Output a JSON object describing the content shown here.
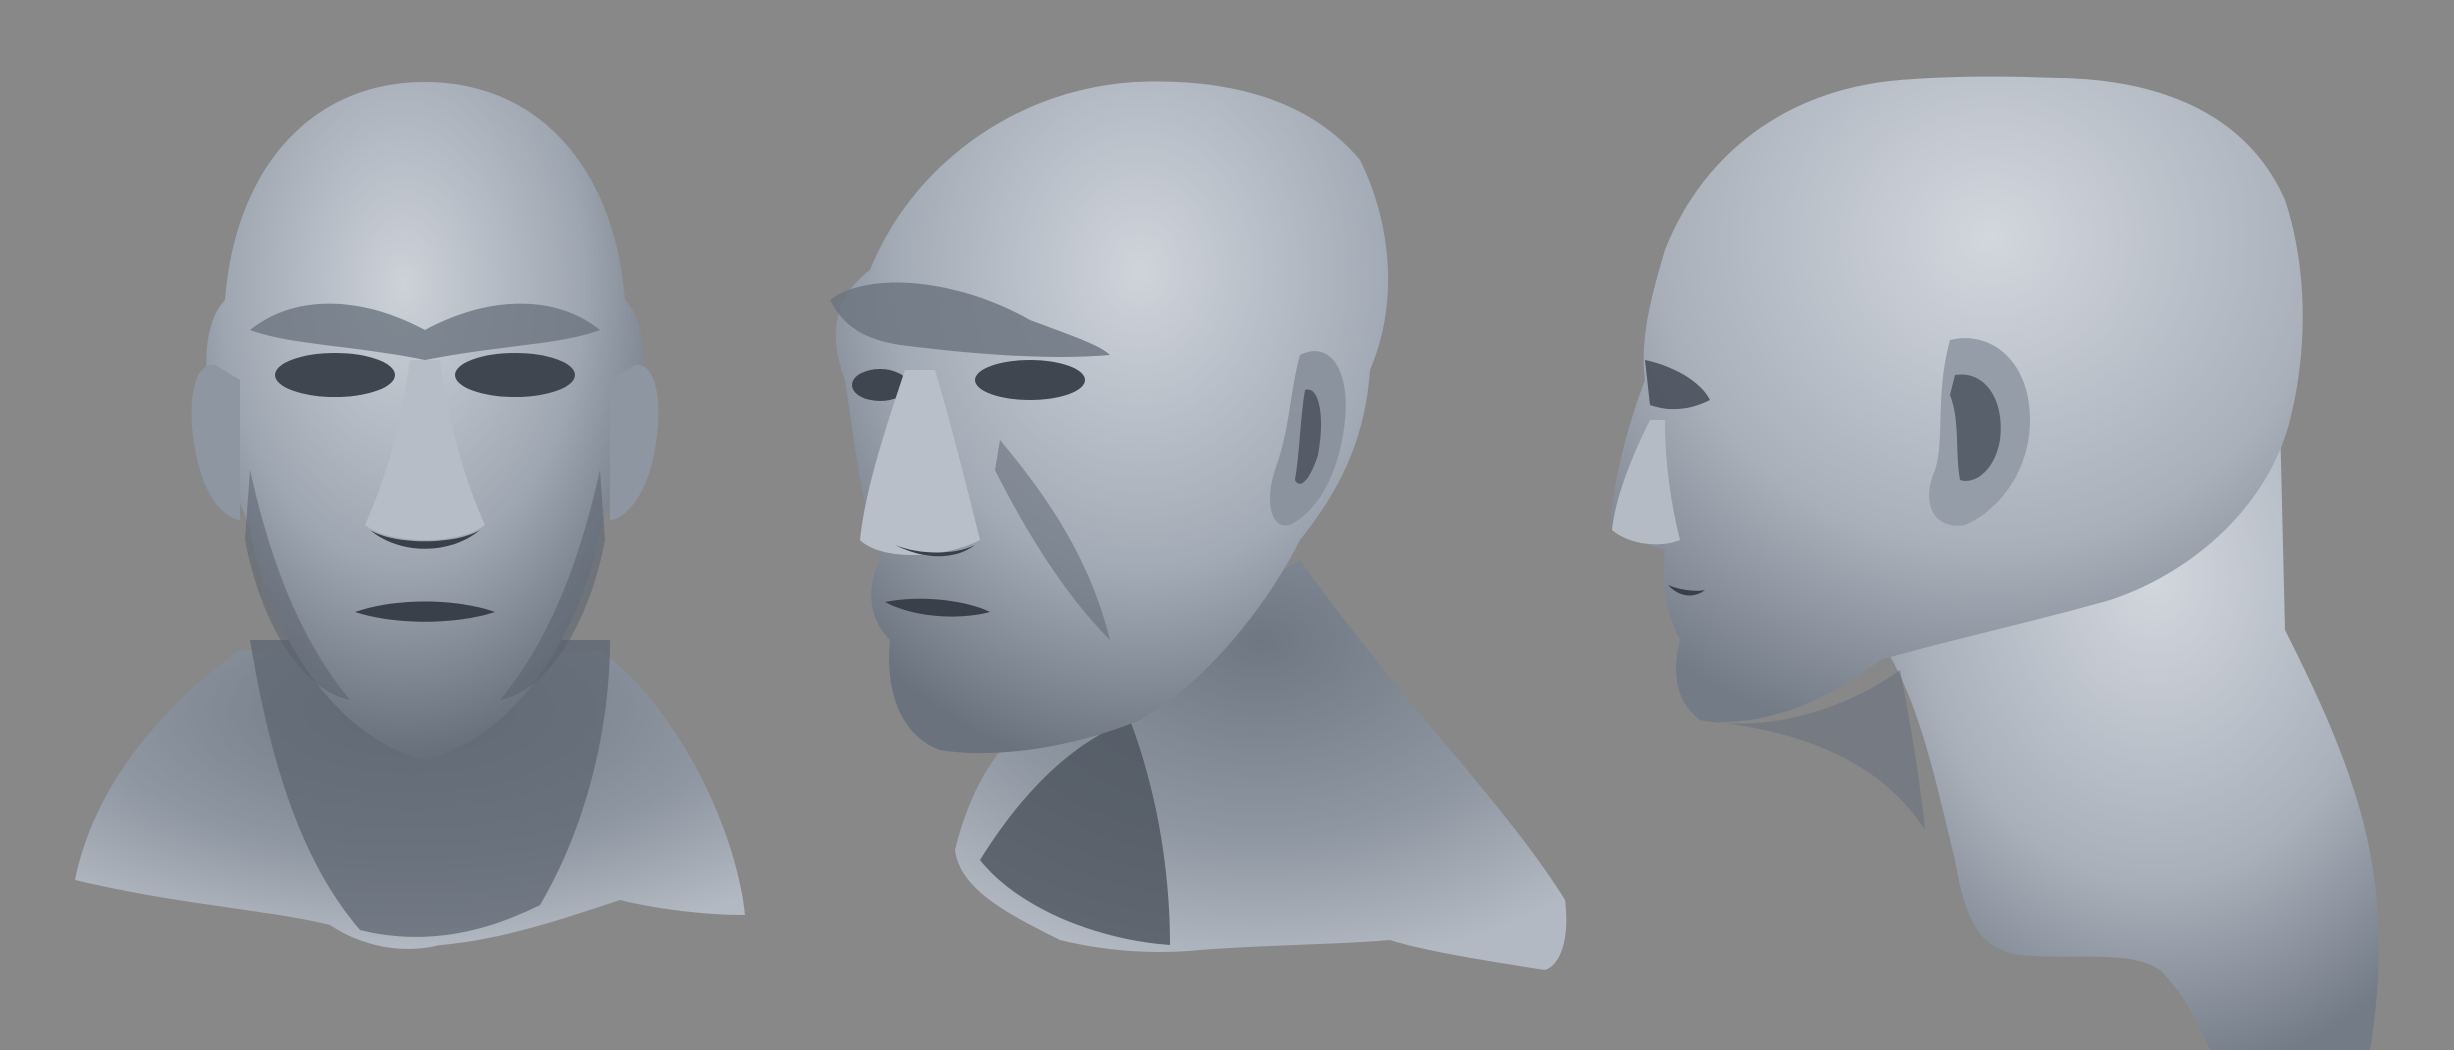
{
  "scene": {
    "background_color": "#888888",
    "clay_light": "#c4c9d1",
    "clay_mid": "#9aa2ad",
    "clay_dark": "#545b66",
    "clay_shadow": "#3a4049",
    "views": [
      {
        "id": "front",
        "label": ""
      },
      {
        "id": "three-quarter",
        "label": ""
      },
      {
        "id": "profile",
        "label": ""
      }
    ]
  }
}
